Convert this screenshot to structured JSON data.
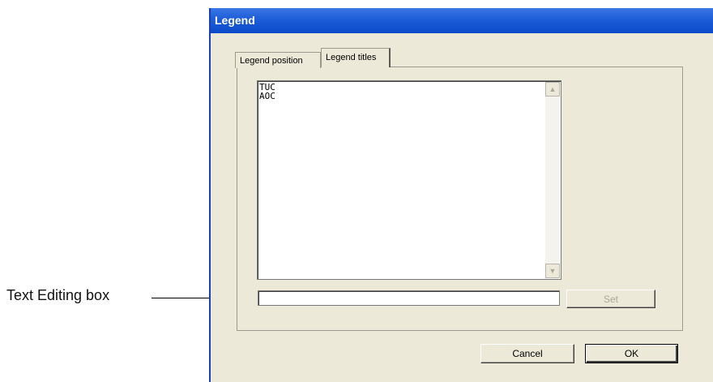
{
  "window": {
    "title": "Legend"
  },
  "tabs": [
    {
      "label": "Legend position",
      "active": false
    },
    {
      "label": "Legend titles",
      "active": true
    }
  ],
  "legend_list": {
    "items": [
      "TUC",
      "AOC"
    ]
  },
  "edit_box": {
    "value": ""
  },
  "buttons": {
    "set": "Set",
    "cancel": "Cancel",
    "ok": "OK"
  },
  "annotation": {
    "label": "Text Editing box"
  },
  "colors": {
    "titlebar": "#0a49c9",
    "dialog_bg": "#ece9d8"
  },
  "icons": {
    "scroll_up": "scroll-up-arrow-icon",
    "scroll_down": "scroll-down-arrow-icon"
  }
}
